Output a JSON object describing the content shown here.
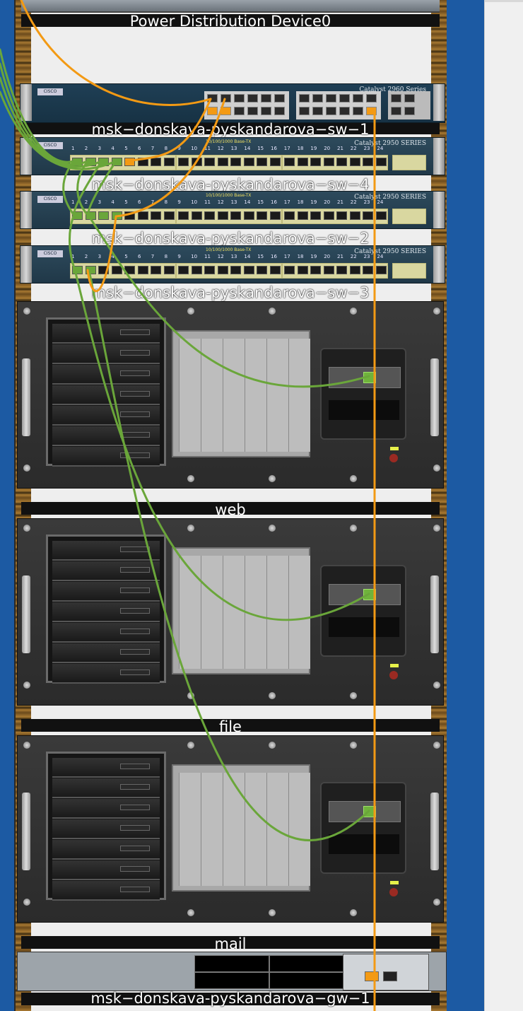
{
  "rack": {
    "devices": [
      {
        "id": "pdu",
        "label": "Power Distribution Device0"
      },
      {
        "id": "sw1",
        "label": "msk−donskava-pyskandarova−sw−1",
        "model": "Catalyst 2960 Series"
      },
      {
        "id": "sw4",
        "label": "msk−donskava-pyskandarova−sw−4",
        "model": "Catalyst 2950 SERIES",
        "speed_label": "10/100/1000 Base-TX"
      },
      {
        "id": "sw2",
        "label": "msk−donskava-pyskandarova−sw−2",
        "model": "Catalyst 2950 SERIES",
        "speed_label": "10/100/1000 Base-TX"
      },
      {
        "id": "sw3",
        "label": "msk−donskava-pyskandarova−sw−3",
        "model": "Catalyst 2950 SERIES",
        "speed_label": "10/100/1000 Base-TX"
      },
      {
        "id": "web",
        "label": "web"
      },
      {
        "id": "file",
        "label": "file"
      },
      {
        "id": "mail",
        "label": "mail"
      },
      {
        "id": "gw1",
        "label": "msk−donskava-pyskandarova−gw−1"
      }
    ],
    "port_numbers": [
      "1",
      "2",
      "3",
      "4",
      "5",
      "6",
      "7",
      "8",
      "9",
      "10",
      "11",
      "12",
      "13",
      "14",
      "15",
      "16",
      "17",
      "18",
      "19",
      "20",
      "21",
      "22",
      "23",
      "24"
    ]
  },
  "colors": {
    "background": "#1c5aa3",
    "copper_straight_cable": "#6aa63a",
    "crossover_cable": "#f39a14"
  }
}
